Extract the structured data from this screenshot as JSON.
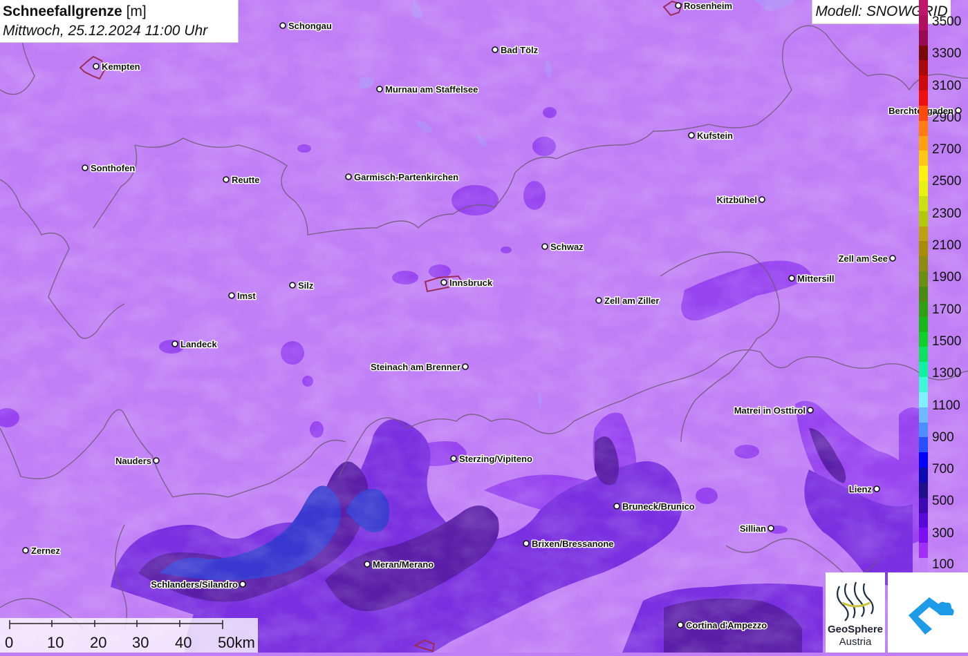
{
  "title": {
    "bold": "Schneefallgrenze",
    "unit": "[m]",
    "datetime": "Mittwoch, 25.12.2024 11:00 Uhr"
  },
  "model": "Modell: SNOWGRID",
  "legend": {
    "labels": [
      "3500",
      "3300",
      "3100",
      "2900",
      "2700",
      "2500",
      "2300",
      "2100",
      "1900",
      "1700",
      "1500",
      "1300",
      "1100",
      "900",
      "700",
      "500",
      "300",
      "100"
    ],
    "colors": [
      "#c0166a",
      "#b0105e",
      "#960c50",
      "#7a0808",
      "#a80a0a",
      "#cc0c0c",
      "#ee1010",
      "#ff4a10",
      "#ff7c10",
      "#ffa010",
      "#ffc810",
      "#fff010",
      "#e8f210",
      "#c8e210",
      "#b4c80a",
      "#c0a010",
      "#a88c08",
      "#8c8c10",
      "#6a9010",
      "#4a8a10",
      "#30a010",
      "#18b818",
      "#10d02a",
      "#10e060",
      "#10f0a0",
      "#40f8d8",
      "#80f0ff",
      "#70b8ff",
      "#4c90ff",
      "#2850ff",
      "#0000ff",
      "#0a0ab0",
      "#20108a",
      "#3c0ab0",
      "#5a0ad8",
      "#7a10f0",
      "#a030f8",
      "#c080f8"
    ]
  },
  "map_colors": {
    "background": "#c07ef6",
    "medium": "#8a3ef2",
    "deep": "#6a28d0",
    "dark": "#4a1a8c",
    "blue": "#2838d8"
  },
  "cities": [
    {
      "name": "Rosenheim",
      "anchor": "left"
    },
    {
      "name": "Schongau",
      "anchor": "left"
    },
    {
      "name": "Kempten",
      "anchor": "left"
    },
    {
      "name": "Bad Tölz",
      "anchor": "left"
    },
    {
      "name": "Murnau am Staffelsee",
      "anchor": "left"
    },
    {
      "name": "Berchtesgaden",
      "anchor": "right"
    },
    {
      "name": "Kufstein",
      "anchor": "left"
    },
    {
      "name": "Sonthofen",
      "anchor": "left"
    },
    {
      "name": "Reutte",
      "anchor": "left"
    },
    {
      "name": "Garmisch-Partenkirchen",
      "anchor": "left"
    },
    {
      "name": "Kitzbühel",
      "anchor": "right"
    },
    {
      "name": "Schwaz",
      "anchor": "left"
    },
    {
      "name": "Zell am See",
      "anchor": "right"
    },
    {
      "name": "Mittersill",
      "anchor": "left"
    },
    {
      "name": "Innsbruck",
      "anchor": "left"
    },
    {
      "name": "Silz",
      "anchor": "left"
    },
    {
      "name": "Imst",
      "anchor": "left"
    },
    {
      "name": "Zell am Ziller",
      "anchor": "left"
    },
    {
      "name": "Landeck",
      "anchor": "left"
    },
    {
      "name": "Steinach am Brenner",
      "anchor": "right"
    },
    {
      "name": "Matrei in Osttirol",
      "anchor": "right"
    },
    {
      "name": "Nauders",
      "anchor": "right"
    },
    {
      "name": "Sterzing/Vipiteno",
      "anchor": "left"
    },
    {
      "name": "Lienz",
      "anchor": "right"
    },
    {
      "name": "Bruneck/Brunico",
      "anchor": "left"
    },
    {
      "name": "Sillian",
      "anchor": "right"
    },
    {
      "name": "Brixen/Bressanone",
      "anchor": "left"
    },
    {
      "name": "Zernez",
      "anchor": "left"
    },
    {
      "name": "Meran/Merano",
      "anchor": "left"
    },
    {
      "name": "Schlanders/Silandro",
      "anchor": "right"
    },
    {
      "name": "Cortina d'Ampezzo",
      "anchor": "left"
    }
  ],
  "scale": {
    "labels": [
      "0",
      "10",
      "20",
      "30",
      "40",
      "50km"
    ]
  },
  "logos": {
    "geosphere_line1": "GeoSphere",
    "geosphere_line2": "Austria"
  }
}
